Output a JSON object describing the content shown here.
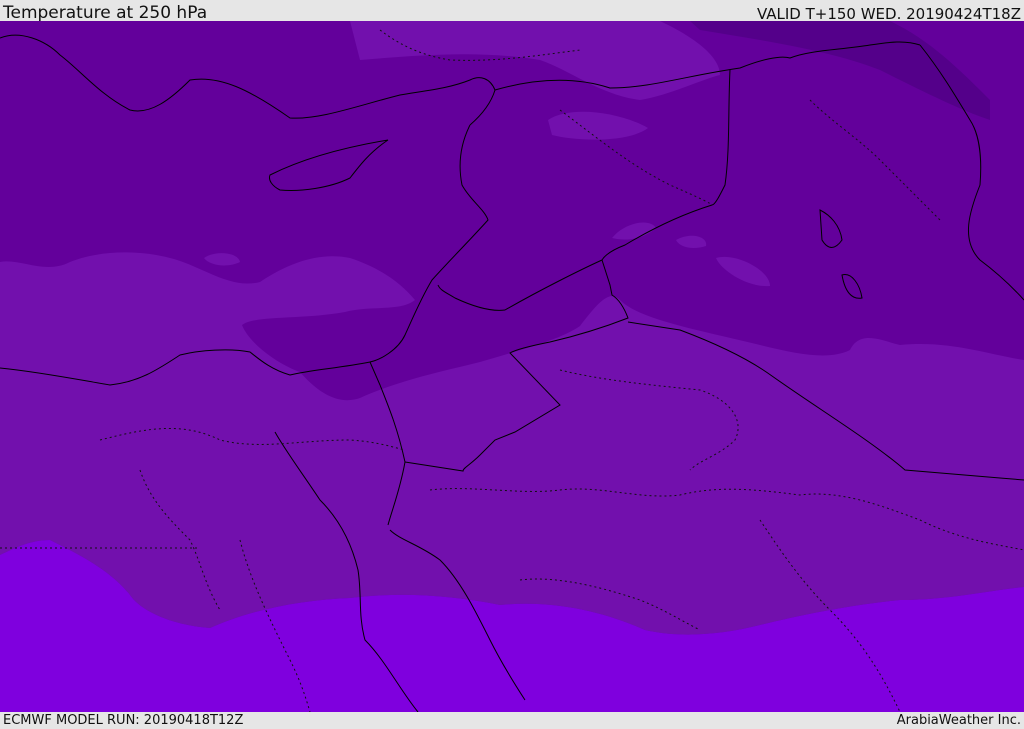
{
  "header": {
    "title": "Temperature at 250 hPa",
    "valid_time": "VALID T+150 WED. 20190424T18Z"
  },
  "footer": {
    "model_run": "ECMWF MODEL RUN: 20190418T12Z",
    "credit": "ArabiaWeather Inc."
  },
  "map": {
    "field": "temperature",
    "level": "250 hPa",
    "colors": {
      "coldest": "#54008a",
      "cold": "#63009b",
      "mid": "#7210ad",
      "warm": "#7f00de",
      "border_line": "#000000"
    }
  }
}
